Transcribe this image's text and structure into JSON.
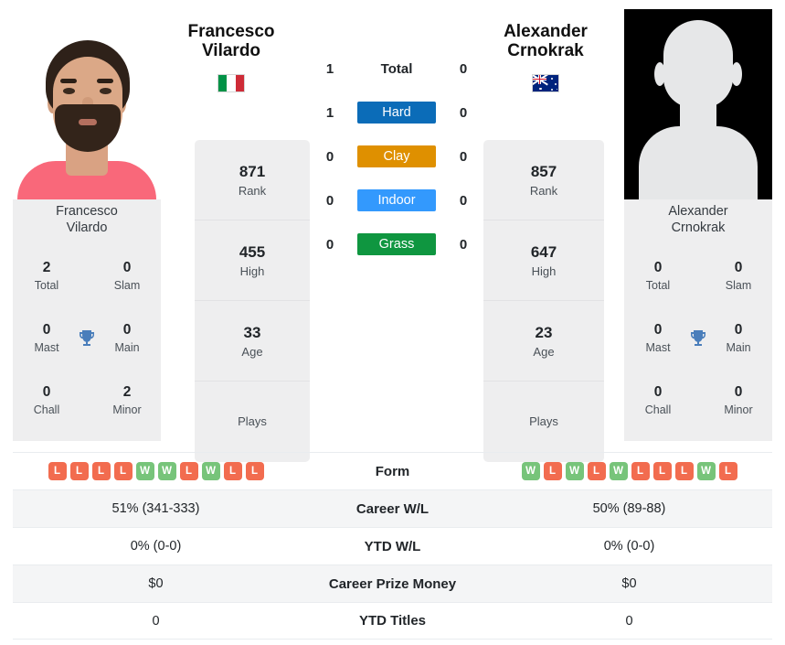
{
  "players": {
    "left": {
      "first_name": "Francesco",
      "last_name": "Vilardo",
      "full_name": "Francesco Vilardo",
      "country": "Italy",
      "flag_icon": "flag-italy-icon",
      "photo_alt": "Francesco Vilardo headshot",
      "rank": "871",
      "rank_label": "Rank",
      "high": "455",
      "high_label": "High",
      "age": "33",
      "age_label": "Age",
      "plays": "",
      "plays_label": "Plays",
      "titles": {
        "total": "2",
        "total_label": "Total",
        "slam": "0",
        "slam_label": "Slam",
        "mast": "0",
        "mast_label": "Mast",
        "main": "0",
        "main_label": "Main",
        "chall": "0",
        "chall_label": "Chall",
        "minor": "2",
        "minor_label": "Minor"
      },
      "form": [
        "L",
        "L",
        "L",
        "L",
        "W",
        "W",
        "L",
        "W",
        "L",
        "L"
      ],
      "career_wl": "51% (341-333)",
      "ytd_wl": "0% (0-0)",
      "career_prize_money": "$0",
      "ytd_titles": "0"
    },
    "right": {
      "first_name": "Alexander",
      "last_name": "Crnokrak",
      "full_name": "Alexander Crnokrak",
      "country": "Australia",
      "flag_icon": "flag-australia-icon",
      "photo_alt": "Alexander Crnokrak placeholder avatar",
      "rank": "857",
      "rank_label": "Rank",
      "high": "647",
      "high_label": "High",
      "age": "23",
      "age_label": "Age",
      "plays": "",
      "plays_label": "Plays",
      "titles": {
        "total": "0",
        "total_label": "Total",
        "slam": "0",
        "slam_label": "Slam",
        "mast": "0",
        "mast_label": "Mast",
        "main": "0",
        "main_label": "Main",
        "chall": "0",
        "chall_label": "Chall",
        "minor": "0",
        "minor_label": "Minor"
      },
      "form": [
        "W",
        "L",
        "W",
        "L",
        "W",
        "L",
        "L",
        "L",
        "W",
        "L"
      ],
      "career_wl": "50% (89-88)",
      "ytd_wl": "0% (0-0)",
      "career_prize_money": "$0",
      "ytd_titles": "0"
    }
  },
  "head_to_head": {
    "rows": [
      {
        "label": "Total",
        "left": "1",
        "right": "0",
        "type": "total",
        "color": ""
      },
      {
        "label": "Hard",
        "left": "1",
        "right": "0",
        "type": "surface",
        "color": "#0b6cb8"
      },
      {
        "label": "Clay",
        "left": "0",
        "right": "0",
        "type": "surface",
        "color": "#df9000"
      },
      {
        "label": "Indoor",
        "left": "0",
        "right": "0",
        "type": "surface",
        "color": "#3399fd"
      },
      {
        "label": "Grass",
        "left": "0",
        "right": "0",
        "type": "surface",
        "color": "#0f9640"
      }
    ]
  },
  "stats_table": {
    "rows": [
      {
        "label": "Form",
        "type": "form"
      },
      {
        "label": "Career W/L",
        "type": "text",
        "key": "career_wl"
      },
      {
        "label": "YTD W/L",
        "type": "text",
        "key": "ytd_wl"
      },
      {
        "label": "Career Prize Money",
        "type": "text",
        "key": "career_prize_money"
      },
      {
        "label": "YTD Titles",
        "type": "text",
        "key": "ytd_titles"
      }
    ]
  },
  "colors": {
    "win_badge": "#77c47a",
    "loss_badge": "#f26c4f",
    "card_bg": "#eeeeef",
    "row_alt": "#f4f5f6",
    "trophy": "#4a7ebb"
  },
  "icons": {
    "trophy": "trophy-icon"
  }
}
